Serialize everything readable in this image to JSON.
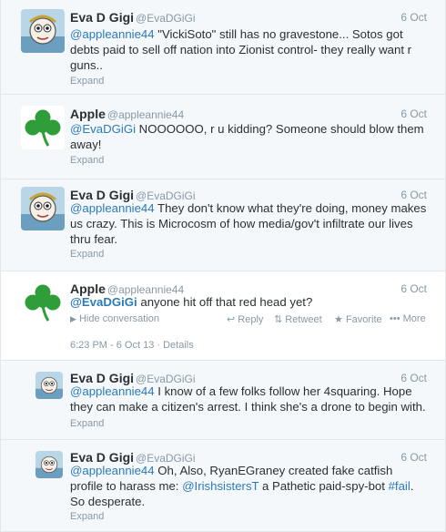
{
  "tweets": [
    {
      "name": "Eva D Gigi",
      "handle": "@EvaDGiGi",
      "time": "6 Oct",
      "mention": "@appleannie44",
      "text": " \"VickiSoto\" still has no gravestone... Sotos got debts paid to sell off nation into Zionist control- they really want r guns..",
      "expand": "Expand"
    },
    {
      "name": "Apple",
      "handle": "@appleannie44",
      "time": "6 Oct",
      "mention": "@EvaDGiGi",
      "text": " NOOOOOO, r u kidding? Someone should blow them away!",
      "expand": "Expand"
    },
    {
      "name": "Eva D Gigi",
      "handle": "@EvaDGiGi",
      "time": "6 Oct",
      "mention": "@appleannie44",
      "text": " They don't know what they're doing, money makes us crazy. This is Microcosm of how media/gov't infiltrate our lives thru fear.",
      "expand": "Expand"
    },
    {
      "name": "Apple",
      "handle": "@appleannie44",
      "time": "6 Oct",
      "mention": "@EvaDGiGi",
      "text": " anyone hit off that red head yet?",
      "hide_label": "Hide conversation",
      "reply_label": "Reply",
      "retweet_label": "Retweet",
      "favorite_label": "Favorite",
      "more_label": "More",
      "timestamp": "6:23 PM - 6 Oct 13",
      "details_label": "Details"
    },
    {
      "name": "Eva D Gigi",
      "handle": "@EvaDGiGi",
      "time": "6 Oct",
      "mention": "@appleannie44",
      "text": " I know of a few folks follow her 4squaring. Hope they can make a citizen's arrest. I think she's a drone to begin with.",
      "expand": "Expand"
    },
    {
      "name": "Eva D Gigi",
      "handle": "@EvaDGiGi",
      "time": "6 Oct",
      "mention": "@appleannie44",
      "text_a": "  Oh, Also, RyanEGraney created fake catfish profile to harass me: ",
      "mention2": "@IrishsistersT",
      "text_b": " a Pathetic paid-spy-bot ",
      "hashtag": "#fail",
      "text_c": ". So desperate.",
      "expand": "Expand"
    }
  ],
  "colors": {
    "link": "#2b7bb9",
    "muted": "#8899a6",
    "clover": "#2f9e3a"
  }
}
